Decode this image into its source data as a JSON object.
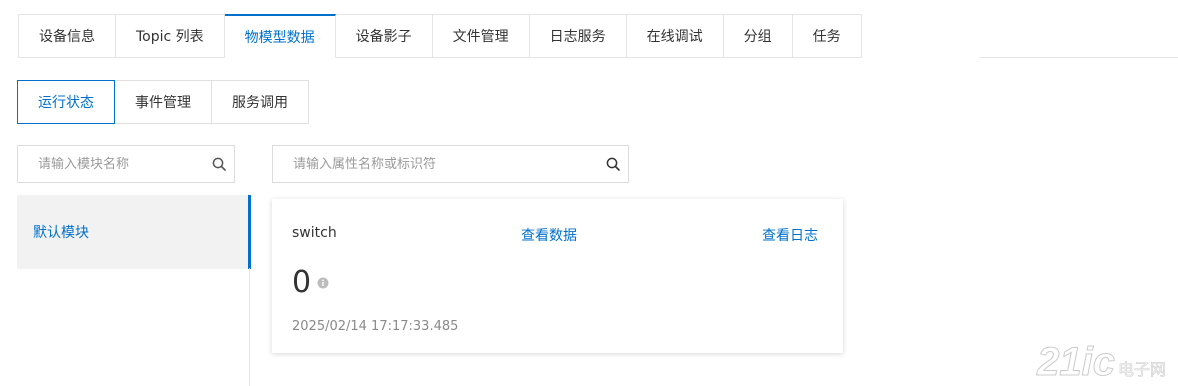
{
  "tabs": [
    {
      "label": "设备信息",
      "active": false
    },
    {
      "label": "Topic 列表",
      "active": false
    },
    {
      "label": "物模型数据",
      "active": true
    },
    {
      "label": "设备影子",
      "active": false
    },
    {
      "label": "文件管理",
      "active": false
    },
    {
      "label": "日志服务",
      "active": false
    },
    {
      "label": "在线调试",
      "active": false
    },
    {
      "label": "分组",
      "active": false
    },
    {
      "label": "任务",
      "active": false
    }
  ],
  "sub_tabs": [
    {
      "label": "运行状态",
      "active": true
    },
    {
      "label": "事件管理",
      "active": false
    },
    {
      "label": "服务调用",
      "active": false
    }
  ],
  "module_search": {
    "placeholder": "请输入模块名称",
    "value": "",
    "icon": "search-icon"
  },
  "property_search": {
    "placeholder": "请输入属性名称或标识符",
    "value": "",
    "icon": "search-icon"
  },
  "modules": [
    {
      "label": "默认模块",
      "selected": true
    }
  ],
  "property": {
    "name": "switch",
    "view_data": "查看数据",
    "view_log": "查看日志",
    "value": "0",
    "info_icon": "info-icon",
    "timestamp": "2025/02/14 17:17:33.485"
  },
  "watermark": {
    "brand": "21ic",
    "sub": "电子网"
  },
  "colors": {
    "accent": "#0070cc",
    "border": "#e4e4e4",
    "muted": "#8a8a8a",
    "selected_bg": "#f2f2f2"
  }
}
